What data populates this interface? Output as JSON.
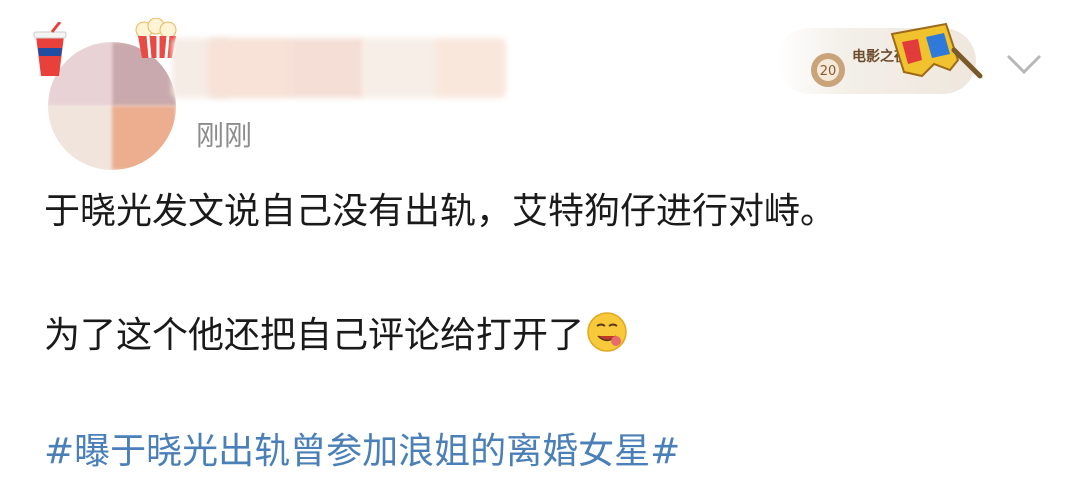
{
  "post": {
    "author_name": "",
    "timestamp": "刚刚",
    "badge": {
      "label_line1": "电影之夜",
      "icon": "3d-glasses-icon"
    },
    "menu_icon": "chevron-down-icon",
    "paragraphs": [
      "于晓光发文说自己没有出轨，艾特狗仔进行对峙。",
      "为了这个他还把自己评论给打开了"
    ],
    "emoji": "yummy-face-icon",
    "hashtag": "#曝于晓光出轨曾参加浪姐的离婚女星#"
  },
  "colors": {
    "hashtag": "#4a80b7",
    "timestamp": "#8c8c8c",
    "text": "#1a1a1a"
  }
}
